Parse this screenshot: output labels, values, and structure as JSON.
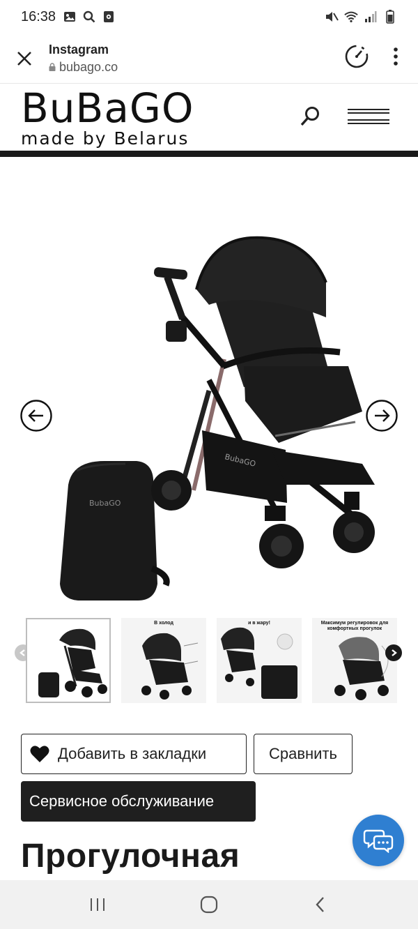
{
  "status_bar": {
    "time": "16:38",
    "left_icons": [
      "image-icon",
      "search-icon",
      "record-icon"
    ],
    "right_icons": [
      "mute-icon",
      "wifi-icon",
      "signal-icon",
      "battery-icon"
    ]
  },
  "browser": {
    "title": "Instagram",
    "url": "bubago.co",
    "close_icon": "close-icon",
    "speed_icon": "speed-dial-icon",
    "more_icon": "more-vert-icon"
  },
  "site": {
    "logo_main": "BuBaGO",
    "logo_sub": "made by Belarus",
    "search_icon": "search-icon",
    "menu_icon": "hamburger-icon"
  },
  "gallery": {
    "prev_icon": "arrow-left-icon",
    "next_icon": "arrow-right-icon",
    "stroller_brand": "BubaGO",
    "bag_brand": "BubaGO",
    "thumbnails": [
      {
        "caption": ""
      },
      {
        "caption": "В холод"
      },
      {
        "caption": "и в жару!"
      },
      {
        "caption": "Максимум регулировок для комфортных прогулок"
      }
    ]
  },
  "actions": {
    "bookmark_label": "Добавить в закладки",
    "compare_label": "Сравнить",
    "service_label": "Сервисное обслуживание"
  },
  "product": {
    "title": "Прогулочная"
  },
  "chat": {
    "icon": "chat-icon",
    "color": "#2f7fd1"
  },
  "nav": {
    "items": [
      "recent-apps-icon",
      "home-icon",
      "back-icon"
    ]
  }
}
